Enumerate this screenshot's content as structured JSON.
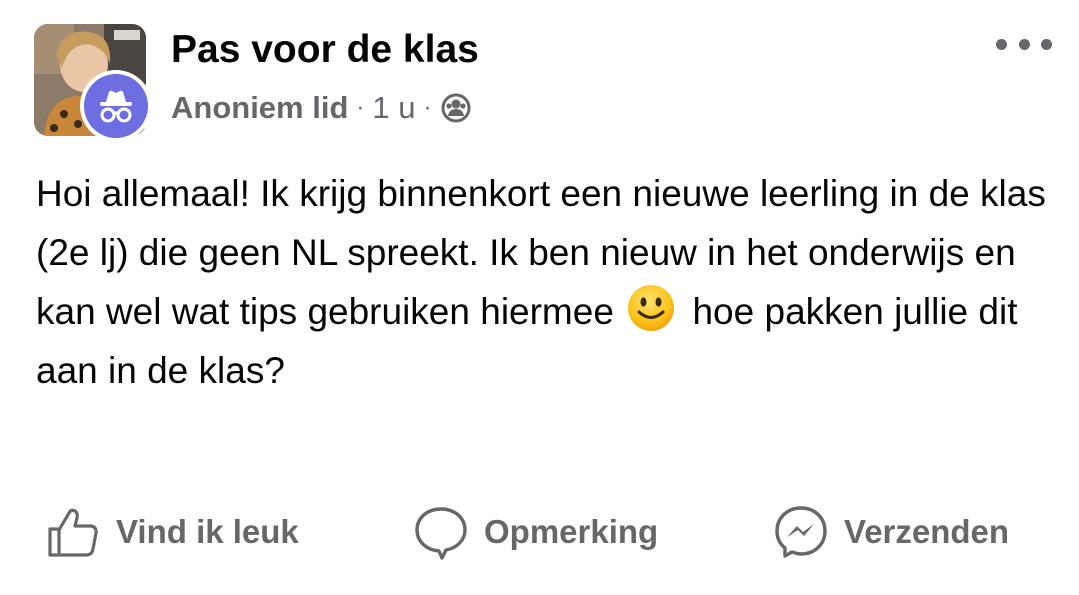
{
  "post": {
    "group_name": "Pas voor de klas",
    "author": "Anoniem lid",
    "separator": "·",
    "time": "1 u",
    "audience_icon": "group-members-icon",
    "more_icon": "more-options-icon",
    "text_parts": [
      "Hoi allemaal! Ik krijg binnenkort een nieuwe leerling in de klas (2e lj) die geen NL spreekt. Ik ben nieuw in het onderwijs en kan wel wat tips gebruiken hiermee",
      "hoe pakken jullie dit aan in de klas?"
    ],
    "emoji": "slightly-smiling-face"
  },
  "actions": {
    "like_label": "Vind ik leuk",
    "comment_label": "Opmerking",
    "send_label": "Verzenden"
  },
  "colors": {
    "text": "#050505",
    "secondary": "#65676b",
    "anon_badge": "#6d6ee0"
  }
}
